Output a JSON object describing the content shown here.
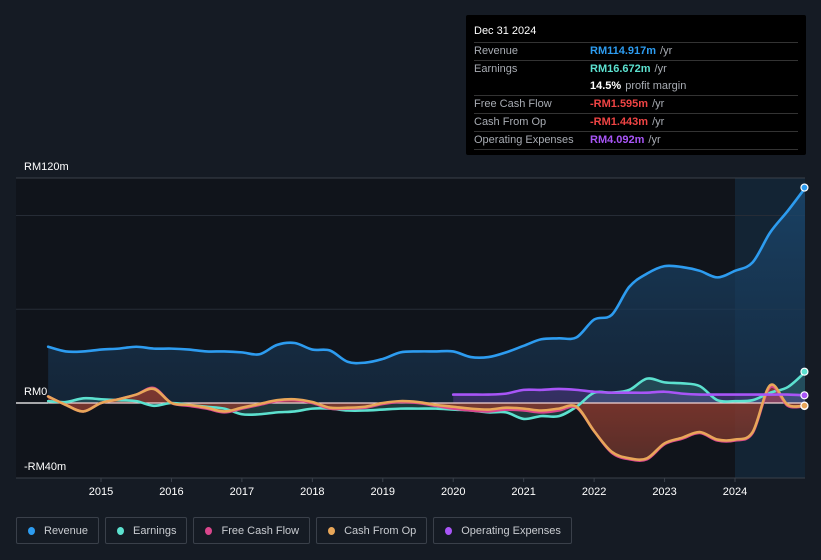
{
  "tooltip": {
    "date": "Dec 31 2024",
    "rows": [
      {
        "label": "Revenue",
        "value": "RM114.917m",
        "unit": "/yr",
        "color": "#2d9cf0"
      },
      {
        "label": "Earnings",
        "value": "RM16.672m",
        "unit": "/yr",
        "color": "#5ce1cf"
      },
      {
        "label": "",
        "value": "14.5%",
        "unit": "profit margin",
        "color": "#ffffff"
      },
      {
        "label": "Free Cash Flow",
        "value": "-RM1.595m",
        "unit": "/yr",
        "color": "#ef4444"
      },
      {
        "label": "Cash From Op",
        "value": "-RM1.443m",
        "unit": "/yr",
        "color": "#ef4444"
      },
      {
        "label": "Operating Expenses",
        "value": "RM4.092m",
        "unit": "/yr",
        "color": "#a855f7"
      }
    ]
  },
  "chart_data": {
    "type": "line",
    "title": "",
    "xlabel": "",
    "ylabel": "",
    "y_tick_labels": [
      "RM120m",
      "RM0",
      "-RM40m"
    ],
    "y_ticks": [
      120,
      0,
      -40
    ],
    "ylim": [
      -40,
      120
    ],
    "xlim": [
      2013.8,
      2025.0
    ],
    "x_tick_labels": [
      "2015",
      "2016",
      "2017",
      "2018",
      "2019",
      "2020",
      "2021",
      "2022",
      "2023",
      "2024"
    ],
    "x_ticks": [
      2015,
      2016,
      2017,
      2018,
      2019,
      2020,
      2021,
      2022,
      2023,
      2024
    ],
    "grid": true,
    "forecast_start": 2024.0,
    "legend_position": "bottom",
    "series": [
      {
        "name": "Revenue",
        "color": "#2d9cf0",
        "x": [
          2014.25,
          2014.5,
          2014.75,
          2015.0,
          2015.25,
          2015.5,
          2015.75,
          2016.0,
          2016.25,
          2016.5,
          2016.75,
          2017.0,
          2017.25,
          2017.5,
          2017.75,
          2018.0,
          2018.25,
          2018.5,
          2018.75,
          2019.0,
          2019.25,
          2019.5,
          2019.75,
          2020.0,
          2020.25,
          2020.5,
          2020.75,
          2021.0,
          2021.25,
          2021.5,
          2021.75,
          2022.0,
          2022.25,
          2022.5,
          2022.75,
          2023.0,
          2023.25,
          2023.5,
          2023.75,
          2024.0,
          2024.25,
          2024.5,
          2024.75,
          2025.0
        ],
        "values": [
          30,
          27.5,
          27.5,
          28.5,
          29,
          30,
          29,
          29,
          28.5,
          27.5,
          27.5,
          27,
          26,
          31,
          32,
          28.5,
          28,
          22,
          21.5,
          23.5,
          27,
          27.5,
          27.5,
          27.5,
          24.5,
          24.5,
          27,
          30.5,
          34,
          34.5,
          35,
          44.5,
          47,
          62,
          69,
          73,
          72.5,
          70.5,
          67,
          70.5,
          75,
          91,
          102.5,
          114.9
        ]
      },
      {
        "name": "Earnings",
        "color": "#5ce1cf",
        "x": [
          2014.25,
          2014.5,
          2014.75,
          2015.0,
          2015.25,
          2015.5,
          2015.75,
          2016.0,
          2016.25,
          2016.5,
          2016.75,
          2017.0,
          2017.25,
          2017.5,
          2017.75,
          2018.0,
          2018.25,
          2018.5,
          2018.75,
          2019.0,
          2019.25,
          2019.5,
          2019.75,
          2020.0,
          2020.25,
          2020.5,
          2020.75,
          2021.0,
          2021.25,
          2021.5,
          2021.75,
          2022.0,
          2022.25,
          2022.5,
          2022.75,
          2023.0,
          2023.25,
          2023.5,
          2023.75,
          2024.0,
          2024.25,
          2024.5,
          2024.75,
          2025.0
        ],
        "values": [
          1,
          0.5,
          2.5,
          2,
          1.5,
          1,
          -1.5,
          0,
          -1,
          -2,
          -3,
          -6,
          -6,
          -5,
          -4.5,
          -3,
          -3,
          -4,
          -4,
          -3.5,
          -3,
          -3,
          -3,
          -3.5,
          -4,
          -5,
          -5,
          -8.5,
          -7,
          -7,
          -2,
          5.5,
          5.5,
          7,
          13,
          11,
          10.5,
          9,
          1.5,
          1,
          1.5,
          5.5,
          8.5,
          16.7
        ]
      },
      {
        "name": "Free Cash Flow",
        "color": "#d9468c",
        "x": [
          2014.25,
          2014.5,
          2014.75,
          2015.0,
          2015.25,
          2015.5,
          2015.75,
          2016.0,
          2016.25,
          2016.5,
          2016.75,
          2017.0,
          2017.25,
          2017.5,
          2017.75,
          2018.0,
          2018.25,
          2018.5,
          2018.75,
          2019.0,
          2019.25,
          2019.5,
          2019.75,
          2020.0,
          2020.25,
          2020.5,
          2020.75,
          2021.0,
          2021.25,
          2021.5,
          2021.75,
          2022.0,
          2022.25,
          2022.5,
          2022.75,
          2023.0,
          2023.25,
          2023.5,
          2023.75,
          2024.0,
          2024.25,
          2024.5,
          2024.75,
          2025.0
        ],
        "values": [
          3.5,
          -1,
          -4.5,
          0,
          2,
          4.5,
          8,
          0,
          -1.5,
          -3,
          -5,
          -3,
          -1,
          1,
          1.5,
          0,
          -3,
          -3,
          -2.5,
          -0.5,
          0.5,
          0,
          -1.5,
          -3,
          -4,
          -4.5,
          -3.5,
          -4,
          -5,
          -4,
          -2.5,
          -15,
          -26.5,
          -30,
          -30,
          -22,
          -19,
          -16,
          -20,
          -20,
          -16,
          8.5,
          -1.5,
          -1.6
        ]
      },
      {
        "name": "Cash From Op",
        "color": "#e8a659",
        "x": [
          2014.25,
          2014.5,
          2014.75,
          2015.0,
          2015.25,
          2015.5,
          2015.75,
          2016.0,
          2016.25,
          2016.5,
          2016.75,
          2017.0,
          2017.25,
          2017.5,
          2017.75,
          2018.0,
          2018.25,
          2018.5,
          2018.75,
          2019.0,
          2019.25,
          2019.5,
          2019.75,
          2020.0,
          2020.25,
          2020.5,
          2020.75,
          2021.0,
          2021.25,
          2021.5,
          2021.75,
          2022.0,
          2022.25,
          2022.5,
          2022.75,
          2023.0,
          2023.25,
          2023.5,
          2023.75,
          2024.0,
          2024.25,
          2024.5,
          2024.75,
          2025.0
        ],
        "values": [
          3.5,
          -1,
          -4.5,
          0,
          2,
          4.5,
          7.5,
          0,
          -1,
          -2.5,
          -4.5,
          -2.5,
          -0.5,
          1.5,
          2,
          0.5,
          -2.5,
          -2.5,
          -2,
          0,
          1,
          0.5,
          -1,
          -2,
          -3,
          -3.5,
          -2.5,
          -3,
          -4,
          -3,
          -2,
          -15,
          -26,
          -29.5,
          -29.5,
          -21.5,
          -18.5,
          -15.5,
          -19.5,
          -19.5,
          -15.5,
          9.5,
          -1,
          -1.4
        ]
      },
      {
        "name": "Operating Expenses",
        "color": "#a855f7",
        "x": [
          2020.0,
          2020.25,
          2020.5,
          2020.75,
          2021.0,
          2021.25,
          2021.5,
          2021.75,
          2022.0,
          2022.25,
          2022.5,
          2022.75,
          2023.0,
          2023.25,
          2023.5,
          2023.75,
          2024.0,
          2024.25,
          2024.5,
          2024.75,
          2025.0
        ],
        "values": [
          4.5,
          4.5,
          4.5,
          5,
          7,
          7,
          7.5,
          7,
          6,
          5.5,
          5.5,
          5.5,
          6,
          5,
          4.5,
          4.5,
          4.5,
          4.5,
          4.5,
          4.5,
          4.1
        ]
      }
    ]
  },
  "legend": {
    "items": [
      {
        "label": "Revenue",
        "color": "#2d9cf0"
      },
      {
        "label": "Earnings",
        "color": "#5ce1cf"
      },
      {
        "label": "Free Cash Flow",
        "color": "#d9468c"
      },
      {
        "label": "Cash From Op",
        "color": "#e8a659"
      },
      {
        "label": "Operating Expenses",
        "color": "#a855f7"
      }
    ]
  }
}
